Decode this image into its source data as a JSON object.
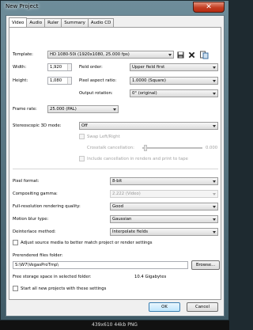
{
  "window": {
    "title": "New Project",
    "close_glyph": "✕"
  },
  "tabs": [
    "Video",
    "Audio",
    "Ruler",
    "Summary",
    "Audio CD"
  ],
  "video": {
    "template_label": "Template:",
    "template_value": "HD 1080-50i (1920x1080, 25.000 fps)",
    "width_label": "Width:",
    "width_value": "1,920",
    "height_label": "Height:",
    "height_value": "1,080",
    "field_order_label": "Field order:",
    "field_order_value": "Upper field first",
    "pixel_aspect_label": "Pixel aspect ratio:",
    "pixel_aspect_value": "1.0000 (Square)",
    "output_rotation_label": "Output rotation:",
    "output_rotation_value": "0° (original)",
    "frame_rate_label": "Frame rate:",
    "frame_rate_value": "25.000 (PAL)",
    "stereo_label": "Stereoscopic 3D mode:",
    "stereo_value": "Off",
    "swap_label": "Swap Left/Right",
    "crosstalk_label": "Crosstalk cancellation:",
    "crosstalk_value": "0.000",
    "include_cancel_label": "Include cancellation in renders and print to tape",
    "pixel_format_label": "Pixel format:",
    "pixel_format_value": "8-bit",
    "compositing_gamma_label": "Compositing gamma:",
    "compositing_gamma_value": "2.222 (Video)",
    "full_res_label": "Full-resolution rendering quality:",
    "full_res_value": "Good",
    "motion_blur_label": "Motion blur type:",
    "motion_blur_value": "Gaussian",
    "deinterlace_label": "Deinterlace method:",
    "deinterlace_value": "Interpolate fields",
    "adjust_source_label": "Adjust source media to better match project or render settings",
    "prerendered_label": "Prerendered files folder:",
    "prerendered_value": "S:\\W7\\VegasProTmp\\",
    "browse_label": "Browse...",
    "free_storage_label": "Free storage space in selected folder:",
    "free_storage_value": "10.4 Gigabytes",
    "start_all_label": "Start all new projects with these settings"
  },
  "buttons": {
    "ok": "OK",
    "cancel": "Cancel"
  },
  "caption": "439x610  44kb  PNG",
  "icons": [
    "save-icon",
    "delete-icon",
    "match-media-icon"
  ]
}
